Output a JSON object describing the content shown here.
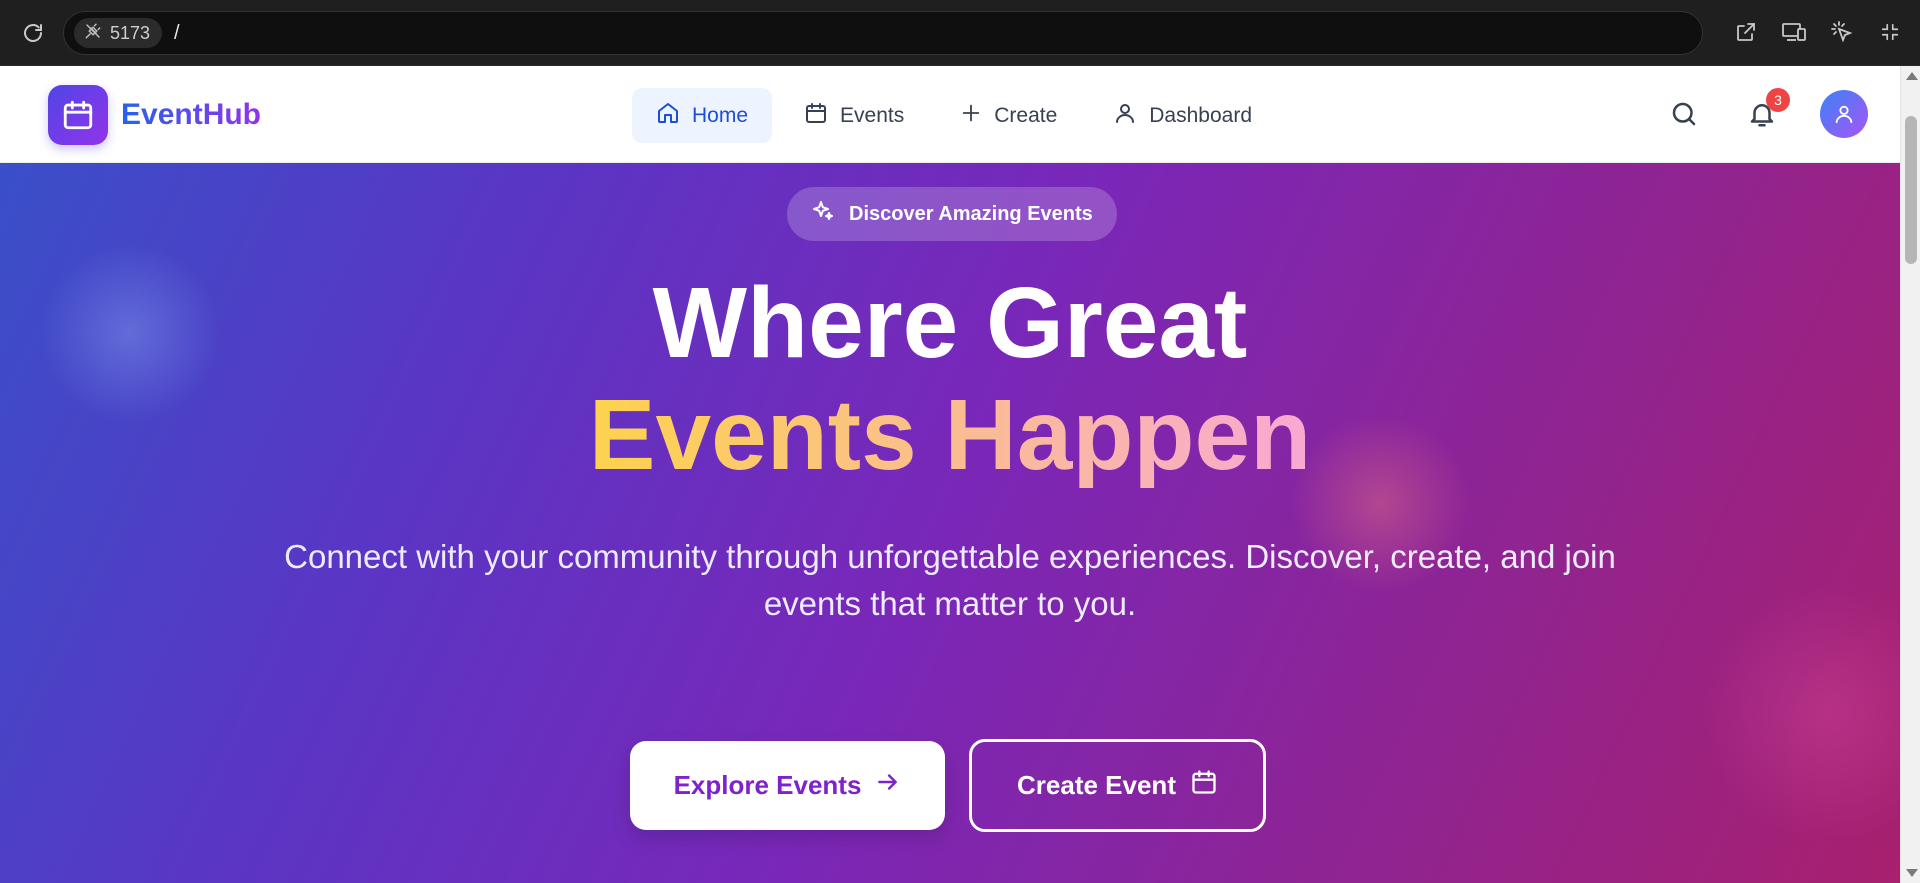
{
  "browser": {
    "port": "5173",
    "path": "/",
    "icons": [
      "reload-icon",
      "plug-off-icon",
      "open-external-icon",
      "devices-icon",
      "cursor-icon",
      "minimize-icon"
    ]
  },
  "nav": {
    "brand": "EventHub",
    "items": [
      {
        "label": "Home",
        "icon": "home-icon",
        "active": true
      },
      {
        "label": "Events",
        "icon": "calendar-icon",
        "active": false
      },
      {
        "label": "Create",
        "icon": "plus-icon",
        "active": false
      },
      {
        "label": "Dashboard",
        "icon": "user-icon",
        "active": false
      }
    ],
    "notification_count": "3"
  },
  "hero": {
    "badge": "Discover Amazing Events",
    "title_line1": "Where Great",
    "title_line2": "Events Happen",
    "subtitle": "Connect with your community through unforgettable experiences. Discover, create, and join events that matter to you.",
    "primary_cta": "Explore Events",
    "secondary_cta": "Create Event"
  },
  "colors": {
    "brand_gradient_start": "#4f46e5",
    "brand_gradient_end": "#9333ea",
    "active_nav_bg": "#eef4ff",
    "active_nav_text": "#1d4ed8",
    "badge_red": "#ef4444",
    "title_highlight_start": "#fcd34d",
    "title_highlight_end": "#f9a8d4"
  }
}
